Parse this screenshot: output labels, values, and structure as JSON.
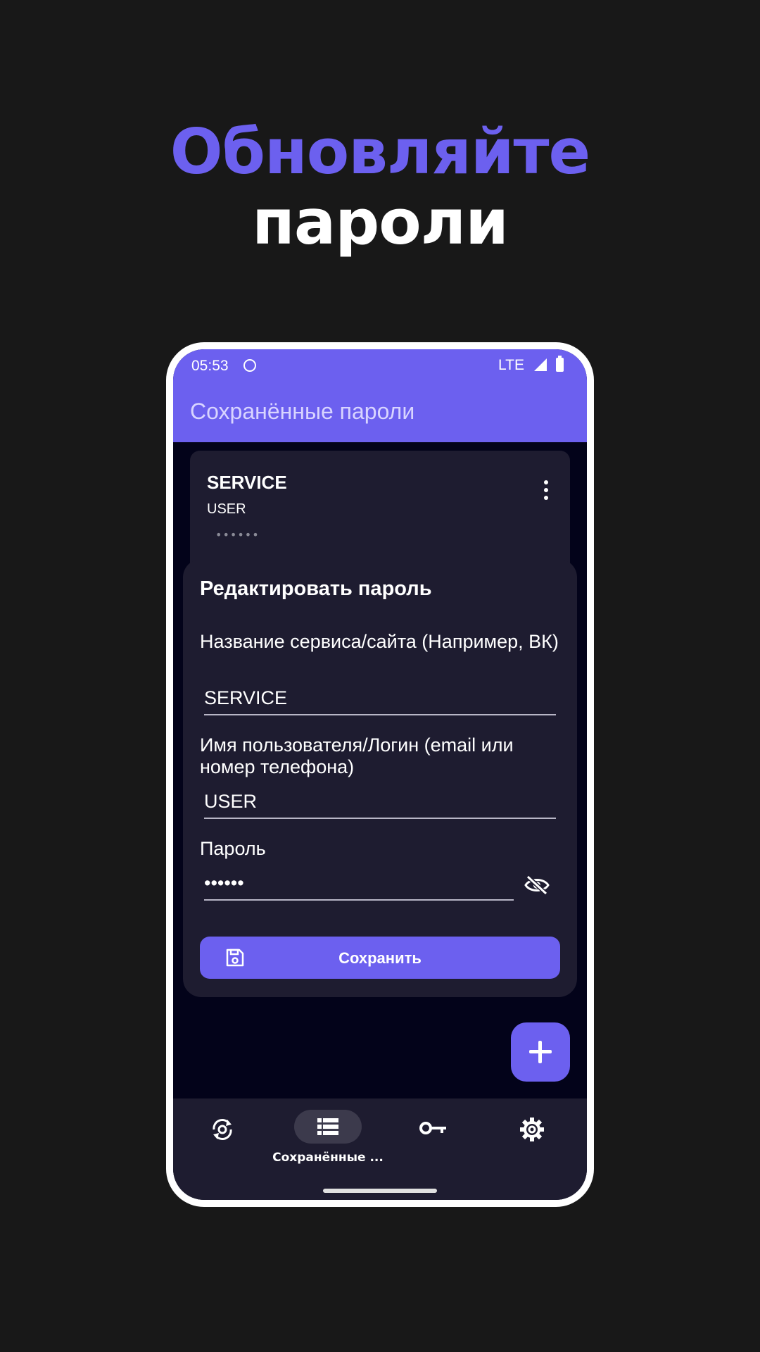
{
  "promo": {
    "line1": "Обновляйте",
    "line2": "пароли"
  },
  "status_bar": {
    "time": "05:53",
    "network": "LTE"
  },
  "app_bar": {
    "title": "Сохранённые пароли"
  },
  "password_card": {
    "service": "SERVICE",
    "user": "USER",
    "password_masked": "••••••"
  },
  "edit_dialog": {
    "title": "Редактировать пароль",
    "service_label": "Название сервиса/сайта (Например, ВК)",
    "service_value": "SERVICE",
    "username_label": "Имя пользователя/Логин (email или номер телефона)",
    "username_value": "USER",
    "password_label": "Пароль",
    "password_value": "••••••",
    "save_label": "Сохранить"
  },
  "bottom_nav": {
    "items": [
      {
        "icon": "sync-settings-icon",
        "label": ""
      },
      {
        "icon": "list-icon",
        "label": "Сохранённые ..."
      },
      {
        "icon": "key-icon",
        "label": ""
      },
      {
        "icon": "gear-icon",
        "label": ""
      }
    ],
    "active_index": 1
  },
  "colors": {
    "accent": "#6c60ef",
    "background": "#181818",
    "surface": "#1e1c30",
    "screen": "#03031a"
  }
}
